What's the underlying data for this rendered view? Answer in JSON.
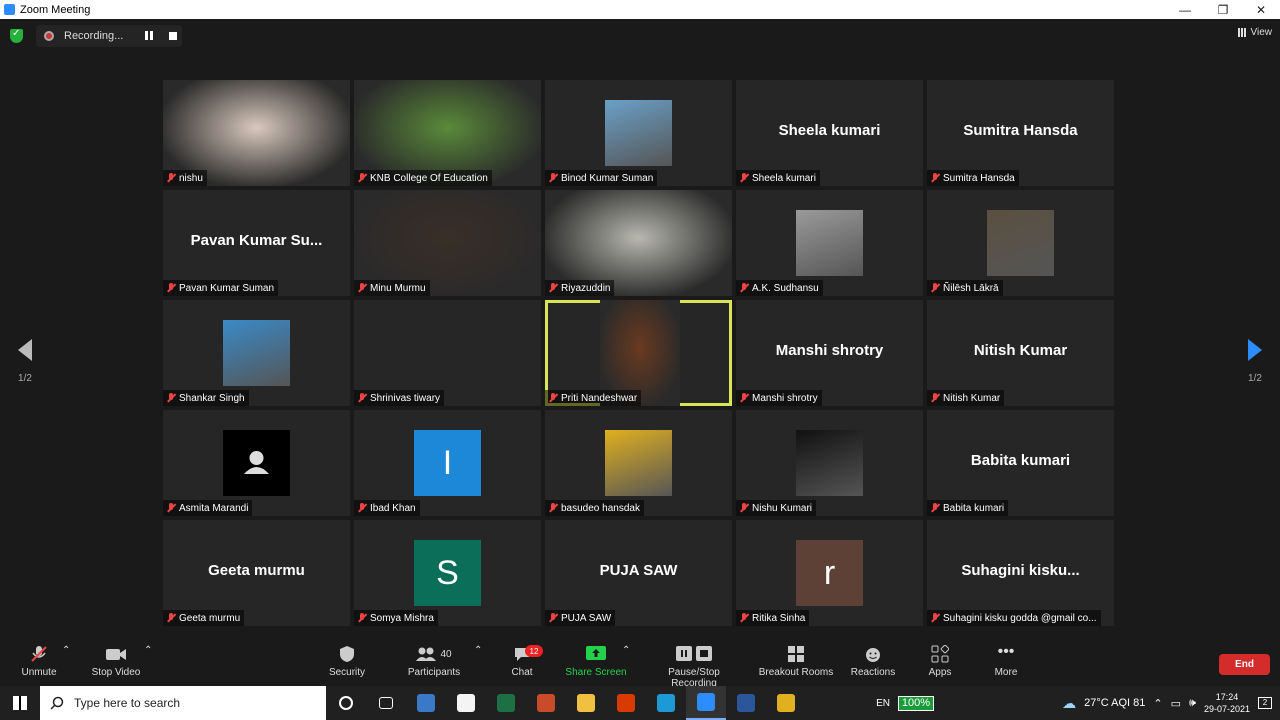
{
  "window": {
    "title": "Zoom Meeting",
    "controls": [
      "—",
      "❐",
      "✕"
    ]
  },
  "recording": {
    "status": "Recording..."
  },
  "view_label": "View",
  "pager": {
    "label": "1/2"
  },
  "participants": [
    {
      "name": "nishu",
      "tile": "video",
      "color": "#d9c9bd"
    },
    {
      "name": "KNB College Of Education",
      "tile": "video",
      "color": "#5a8a3a"
    },
    {
      "name": "Binod Kumar Suman",
      "tile": "photo",
      "color": "#6aa0c8"
    },
    {
      "name": "Sheela kumari",
      "display": "Sheela kumari",
      "tile": "text"
    },
    {
      "name": "Sumitra Hansda",
      "display": "Sumitra Hansda",
      "tile": "text"
    },
    {
      "name": "Pavan Kumar Suman",
      "display": "Pavan Kumar Su...",
      "tile": "text"
    },
    {
      "name": "Minu Murmu",
      "tile": "video",
      "color": "#3a2e28"
    },
    {
      "name": "Riyazuddin",
      "tile": "video",
      "color": "#b8b8b0"
    },
    {
      "name": "A.K. Sudhansu",
      "tile": "photo",
      "color": "#9a9a9a"
    },
    {
      "name": "Ñilēsh Lākrā",
      "tile": "photo",
      "color": "#5a5040"
    },
    {
      "name": "Shankar Singh",
      "tile": "photo",
      "color": "#3a8ac8"
    },
    {
      "name": "Shrinivas tiwary",
      "tile": "blank"
    },
    {
      "name": "Priti Nandeshwar",
      "tile": "video-active",
      "color": "#6a3a20"
    },
    {
      "name": "Manshi shrotry",
      "display": "Manshi shrotry",
      "tile": "text"
    },
    {
      "name": "Nitish Kumar",
      "display": "Nitish Kumar",
      "tile": "text"
    },
    {
      "name": "Asmita Marandi",
      "tile": "avatar",
      "color": "#000000"
    },
    {
      "name": "Ibad Khan",
      "tile": "initial",
      "initial": "I",
      "color": "#1e88d8"
    },
    {
      "name": "basudeo hansdak",
      "tile": "photo",
      "color": "#e0b020"
    },
    {
      "name": "Nishu Kumari",
      "tile": "photo",
      "color": "#111111"
    },
    {
      "name": "Babita kumari",
      "display": "Babita kumari",
      "tile": "text"
    },
    {
      "name": "Geeta murmu",
      "display": "Geeta murmu",
      "tile": "text"
    },
    {
      "name": "Somya Mishra",
      "tile": "initial",
      "initial": "S",
      "color": "#0b6e58"
    },
    {
      "name": "PUJA SAW",
      "display": "PUJA SAW",
      "tile": "text"
    },
    {
      "name": "Ritika Sinha",
      "tile": "initial",
      "initial": "r",
      "color": "#5e4136"
    },
    {
      "name": "Suhagini kisku godda  @gmail co...",
      "display": "Suhagini  kisku...",
      "tile": "text"
    }
  ],
  "toolbar": {
    "unmute": "Unmute",
    "stop_video": "Stop Video",
    "security": "Security",
    "participants": "Participants",
    "participants_count": "40",
    "chat": "Chat",
    "chat_badge": "12",
    "share_screen": "Share Screen",
    "pause_stop_recording": "Pause/Stop Recording",
    "breakout_rooms": "Breakout Rooms",
    "reactions": "Reactions",
    "apps": "Apps",
    "more": "More",
    "end": "End"
  },
  "taskbar": {
    "search_placeholder": "Type here to search",
    "apps": [
      {
        "icon": "task-view-icon",
        "color": "#202020"
      },
      {
        "icon": "widgets-icon",
        "color": "#202020"
      },
      {
        "icon": "snip-icon",
        "color": "#3a78c8"
      },
      {
        "icon": "store-icon",
        "color": "#f4f4f4"
      },
      {
        "icon": "excel-icon",
        "color": "#1d7044"
      },
      {
        "icon": "app-red-icon",
        "color": "#c84b2a"
      },
      {
        "icon": "file-explorer-icon",
        "color": "#f0c040"
      },
      {
        "icon": "office-icon",
        "color": "#d83b01"
      },
      {
        "icon": "edge-icon",
        "color": "#1d9ad6"
      },
      {
        "icon": "zoom-icon",
        "color": "#2d8cff"
      },
      {
        "icon": "word-icon",
        "color": "#2b579a"
      },
      {
        "icon": "chrome-icon",
        "color": "#e0b020"
      }
    ],
    "lang": "EN",
    "battery": "100%",
    "weather": "27°C  AQI 81",
    "time": "17:24",
    "date": "29-07-2021",
    "notif_count": "2"
  }
}
